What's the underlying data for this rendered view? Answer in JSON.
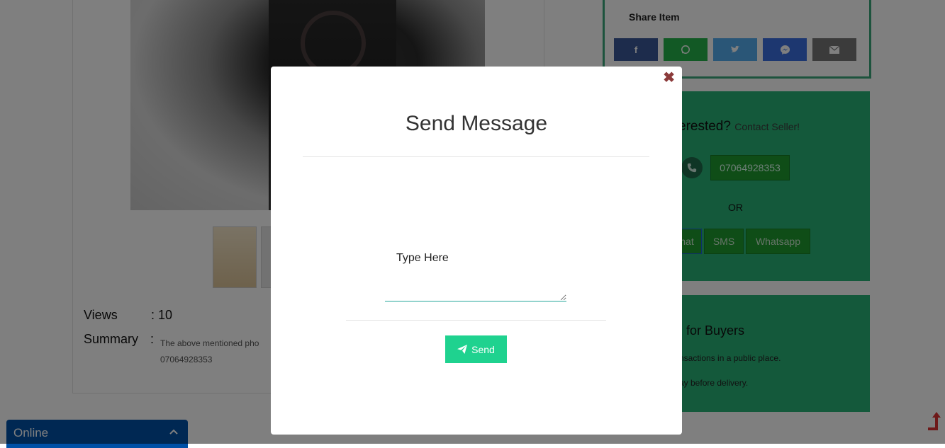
{
  "product": {
    "views_label": "Views",
    "views_colon": ": 10",
    "summary_label": "Summary",
    "summary_colon": ":",
    "summary_text": "The above mentioned pho",
    "summary_phone": "07064928353"
  },
  "share": {
    "title": "Share Item",
    "buttons": [
      {
        "icon": "facebook-icon",
        "glyph": "f",
        "color": "#3b5998"
      },
      {
        "icon": "whatsapp-icon",
        "color": "#25b24a"
      },
      {
        "icon": "twitter-icon",
        "color": "#55acee"
      },
      {
        "icon": "messenger-icon",
        "color": "#3b6fe0"
      },
      {
        "icon": "email-icon",
        "color": "#777777"
      }
    ]
  },
  "contact": {
    "title_partial": "erested?",
    "title_small": "Contact Seller!",
    "phone_number": "07064928353",
    "or_text": "OR",
    "buttons": [
      "hat",
      "SMS",
      "Whatsapp"
    ]
  },
  "buyers": {
    "title_partial": "for Buyers",
    "tip1": "nsactions in a public place.",
    "tip2": "ay before delivery."
  },
  "chat": {
    "label": "Online"
  },
  "modal": {
    "close_glyph": "✖",
    "title": "Send Message",
    "message_placeholder": "Type Here",
    "send_label": "Send"
  },
  "colors": {
    "accent_green": "#1fd28f",
    "panel_green": "#29b277",
    "chat_blue": "#0050a6"
  }
}
